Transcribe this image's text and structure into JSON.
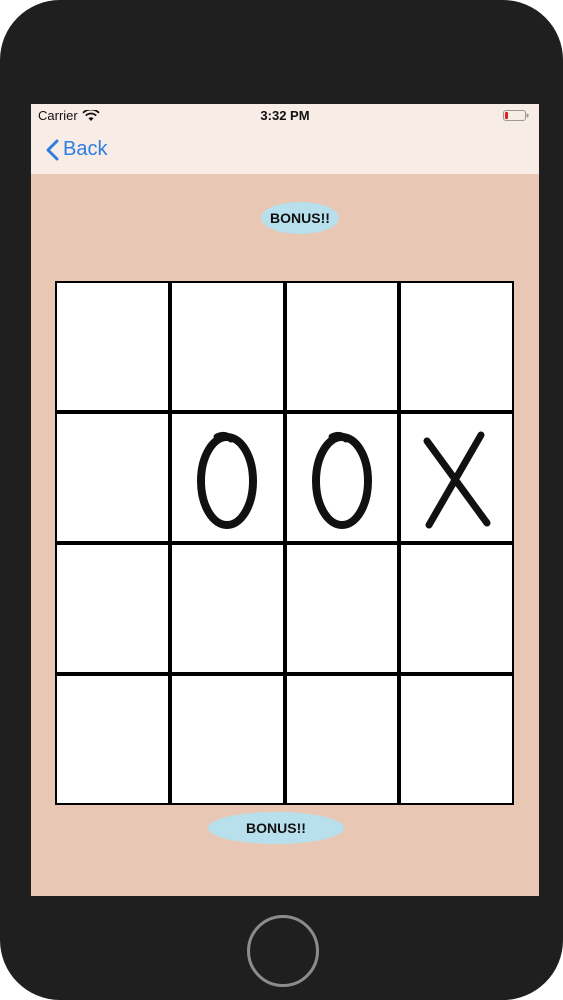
{
  "status": {
    "carrier": "Carrier",
    "time": "3:32 PM",
    "icons": {
      "wifi": "wifi-icon",
      "battery": "battery-low-icon"
    }
  },
  "nav": {
    "back_label": "Back"
  },
  "bonus": {
    "top_label": "BONUS!!",
    "bottom_label": "BONUS!!"
  },
  "board": {
    "rows": 4,
    "cols": 4,
    "cells": [
      [
        "",
        "",
        "",
        ""
      ],
      [
        "",
        "O",
        "O",
        "X"
      ],
      [
        "",
        "",
        "",
        ""
      ],
      [
        "",
        "",
        "",
        ""
      ]
    ]
  },
  "colors": {
    "background": "#e8c8b4",
    "bonus": "#b8dfec",
    "accent": "#2f7de1"
  }
}
